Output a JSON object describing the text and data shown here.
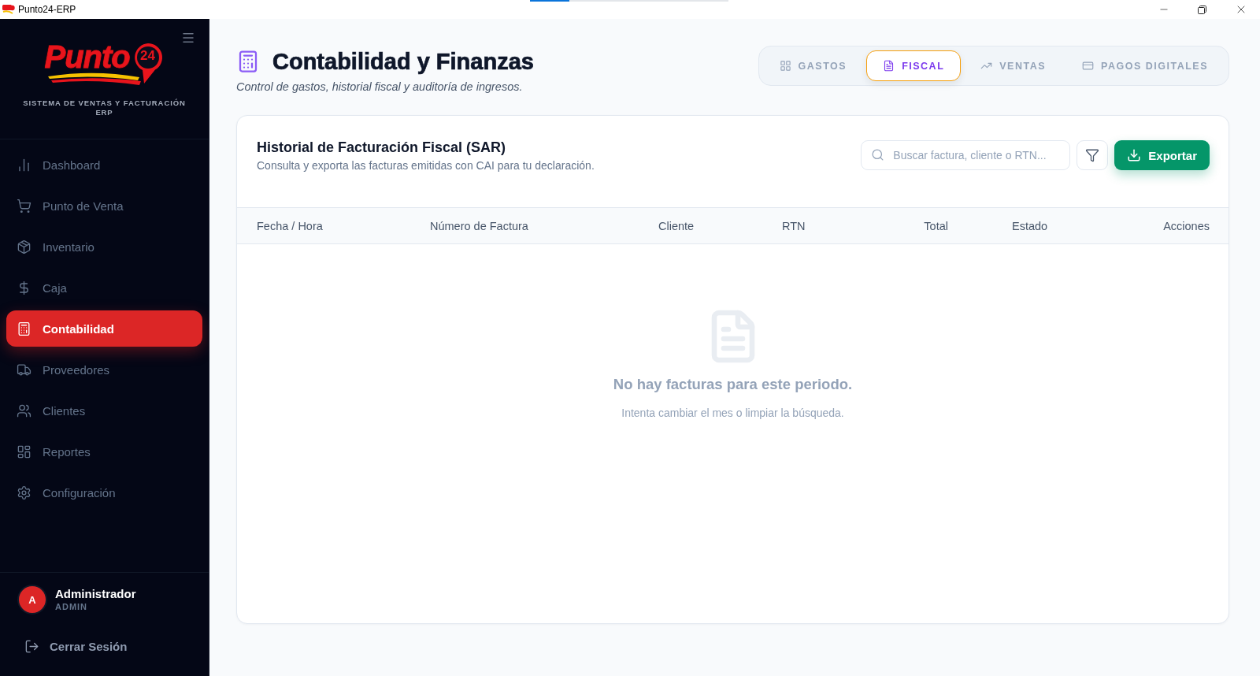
{
  "window": {
    "title": "Punto24-ERP",
    "loading_bar": {
      "level": 0.2
    }
  },
  "sidebar": {
    "logo": {
      "wordmark": "Punto",
      "badge": "24"
    },
    "tagline": "SISTEMA DE VENTAS Y FACTURACIÓN ERP",
    "items": [
      {
        "label": "Dashboard",
        "selected": false
      },
      {
        "label": "Punto de Venta",
        "selected": false
      },
      {
        "label": "Inventario",
        "selected": false
      },
      {
        "label": "Caja",
        "selected": false
      },
      {
        "label": "Contabilidad",
        "selected": true
      },
      {
        "label": "Proveedores",
        "selected": false
      },
      {
        "label": "Clientes",
        "selected": false
      },
      {
        "label": "Reportes",
        "selected": false
      },
      {
        "label": "Configuración",
        "selected": false
      }
    ],
    "user": {
      "initial": "A",
      "name": "Administrador",
      "role": "ADMIN"
    },
    "logout": "Cerrar Sesión"
  },
  "header": {
    "title": "Contabilidad y Finanzas",
    "subtitle": "Control de gastos, historial fiscal y auditoría de ingresos."
  },
  "tabs": [
    {
      "label": "GASTOS",
      "selected": false
    },
    {
      "label": "FISCAL",
      "selected": true
    },
    {
      "label": "VENTAS",
      "selected": false
    },
    {
      "label": "PAGOS DIGITALES",
      "selected": false
    }
  ],
  "fiscal_panel": {
    "title": "Historial de Facturación Fiscal (SAR)",
    "subtitle": "Consulta y exporta las facturas emitidas con CAI para tu declaración.",
    "search": {
      "placeholder": "Buscar factura, cliente o RTN..."
    },
    "export_button": "Exportar",
    "table": {
      "columns": [
        "Fecha / Hora",
        "Número de Factura",
        "Cliente",
        "RTN",
        "Total",
        "Estado",
        "Acciones"
      ]
    },
    "empty_state": {
      "title": "No hay facturas para este periodo.",
      "message": "Intenta cambiar el mes o limpiar la búsqueda."
    }
  }
}
